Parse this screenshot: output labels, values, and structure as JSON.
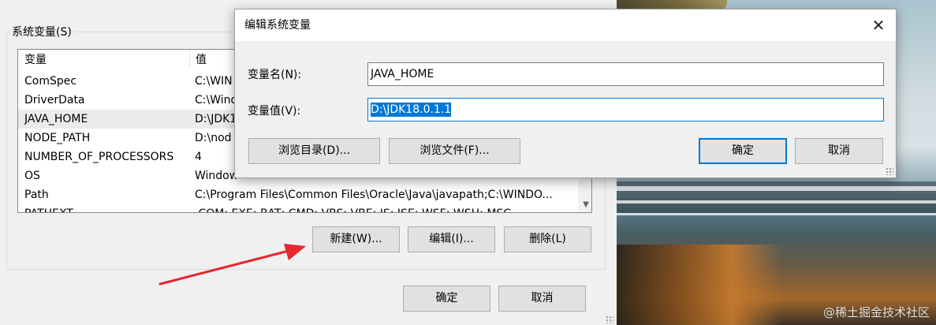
{
  "back_window": {
    "group_label": "系统变量(S)",
    "columns": [
      "变量",
      "值"
    ],
    "rows": [
      {
        "name": "ComSpec",
        "value": "C:\\WIN"
      },
      {
        "name": "DriverData",
        "value": "C:\\Wind"
      },
      {
        "name": "JAVA_HOME",
        "value": "D:\\JDK1"
      },
      {
        "name": "NODE_PATH",
        "value": "D:\\nod"
      },
      {
        "name": "NUMBER_OF_PROCESSORS",
        "value": "4"
      },
      {
        "name": "OS",
        "value": "Window"
      },
      {
        "name": "Path",
        "value": "C:\\Program Files\\Common Files\\Oracle\\Java\\javapath;C:\\WINDO..."
      },
      {
        "name": "PATHEXT",
        "value": ".COM;.EXE;.BAT;.CMD;.VBS;.VBE;.JS;.JSE;.WSF;.WSH;.MSC"
      }
    ],
    "selected_row": 2,
    "buttons": {
      "new": "新建(W)...",
      "edit": "编辑(I)...",
      "delete": "删除(L)"
    },
    "ok": "确定",
    "cancel": "取消"
  },
  "dialog": {
    "title": "编辑系统变量",
    "close_glyph": "✕",
    "name_label": "变量名(N):",
    "name_value": "JAVA_HOME",
    "value_label": "变量值(V):",
    "value_value": "D:\\JDK18.0.1.1",
    "browse_dir": "浏览目录(D)...",
    "browse_file": "浏览文件(F)...",
    "ok": "确定",
    "cancel": "取消"
  },
  "watermark": "@稀土掘金技术社区",
  "colors": {
    "accent": "#0078d7",
    "annotation_arrow": "#e8262b"
  },
  "icons": {
    "close": "close-icon",
    "scroll_down": "chevron-down-icon"
  }
}
